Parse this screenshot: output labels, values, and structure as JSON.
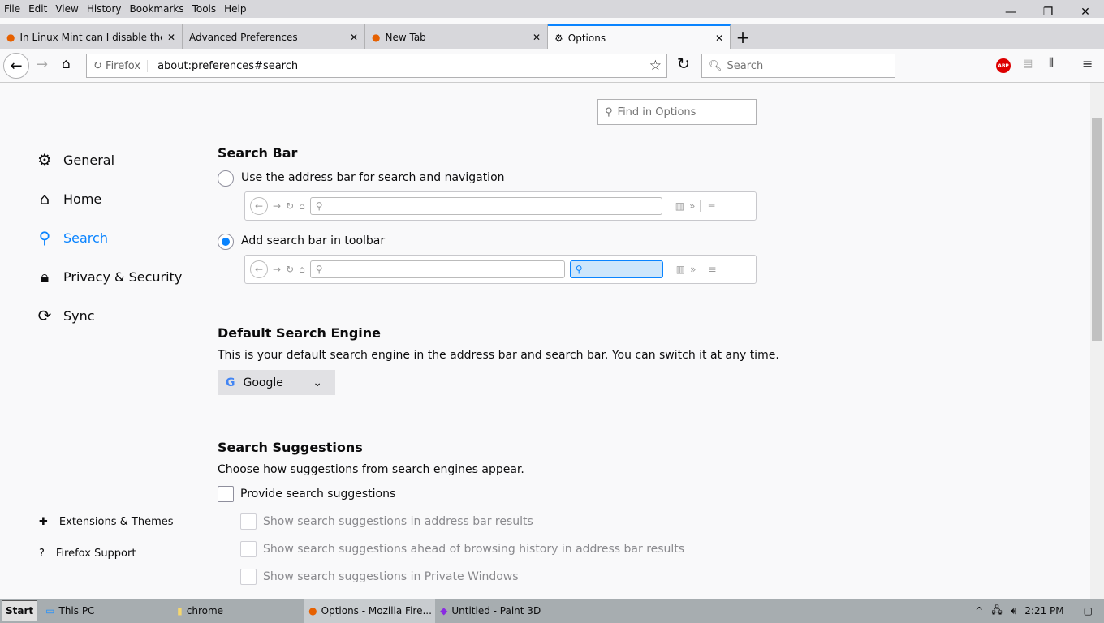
{
  "menu": [
    "File",
    "Edit",
    "View",
    "History",
    "Bookmarks",
    "Tools",
    "Help"
  ],
  "tabs": [
    {
      "label": "In Linux Mint can I disable the s",
      "icon": "firefox-icon"
    },
    {
      "label": "Advanced Preferences",
      "icon": ""
    },
    {
      "label": "New Tab",
      "icon": "firefox-icon"
    },
    {
      "label": "Options",
      "icon": "gear-icon"
    }
  ],
  "nav": {
    "identity": "Firefox",
    "url": "about:preferences#search",
    "search_placeholder": "Search",
    "abp": "ABP"
  },
  "find_placeholder": "Find in Options",
  "sidebar": {
    "items": [
      "General",
      "Home",
      "Search",
      "Privacy & Security",
      "Sync"
    ],
    "bottom": [
      "Extensions & Themes",
      "Firefox Support"
    ]
  },
  "accent": "#0a84ff",
  "search_bar": {
    "title": "Search Bar",
    "opt1": "Use the address bar for search and navigation",
    "opt2": "Add search bar in toolbar",
    "selected": 2
  },
  "engine": {
    "title": "Default Search Engine",
    "desc": "This is your default search engine in the address bar and search bar. You can switch it at any time.",
    "value": "Google"
  },
  "suggestions": {
    "title": "Search Suggestions",
    "desc": "Choose how suggestions from search engines appear.",
    "provide": "Provide search suggestions",
    "sub": [
      "Show search suggestions in address bar results",
      "Show search suggestions ahead of browsing history in address bar results",
      "Show search suggestions in Private Windows"
    ]
  },
  "taskbar": {
    "start": "Start",
    "items": [
      "This PC",
      "chrome",
      "Options - Mozilla Fire...",
      "Untitled - Paint 3D"
    ],
    "time": "2:21 PM"
  }
}
